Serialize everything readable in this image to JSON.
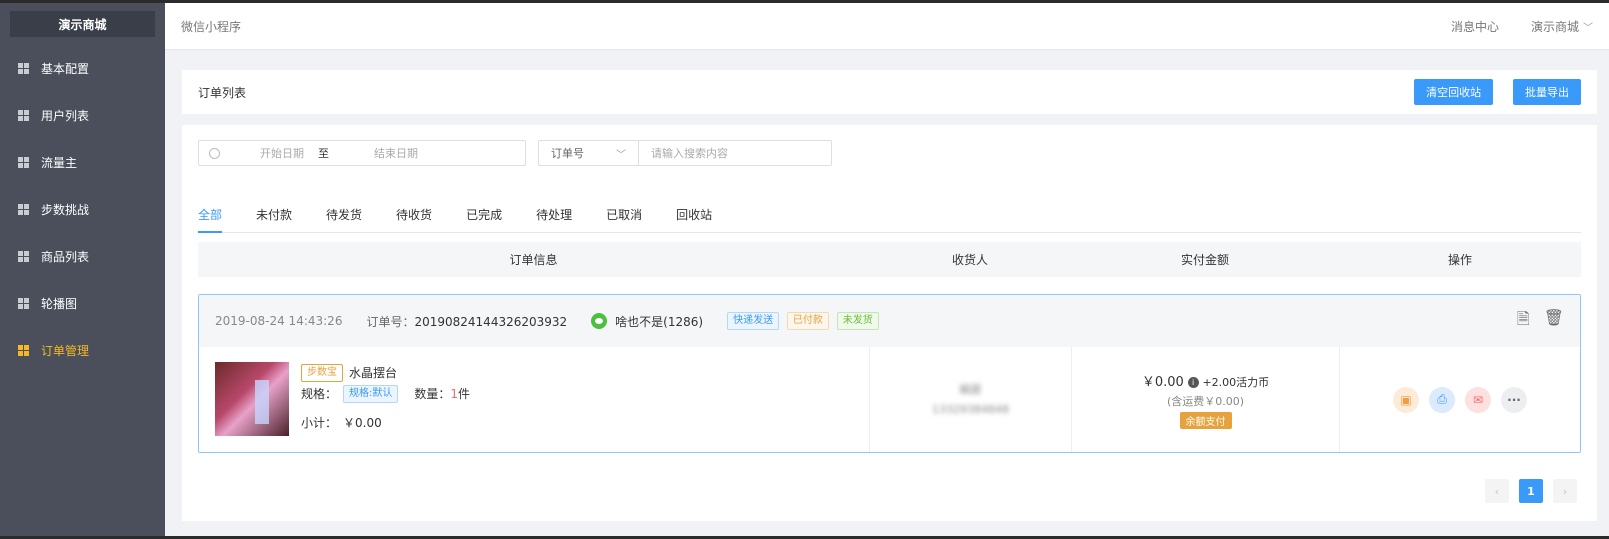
{
  "sidebar": {
    "brand": "演示商城",
    "items": [
      {
        "label": "基本配置",
        "active": false
      },
      {
        "label": "用户列表",
        "active": false
      },
      {
        "label": "流量主",
        "active": false
      },
      {
        "label": "步数挑战",
        "active": false
      },
      {
        "label": "商品列表",
        "active": false
      },
      {
        "label": "轮播图",
        "active": false
      },
      {
        "label": "订单管理",
        "active": true
      }
    ]
  },
  "topbar": {
    "breadcrumb": "微信小程序",
    "messages": "消息中心",
    "store": "演示商城"
  },
  "page": {
    "title": "订单列表",
    "clear_recycle": "清空回收站",
    "batch_export": "批量导出"
  },
  "filter": {
    "start_placeholder": "开始日期",
    "separator": "至",
    "end_placeholder": "结束日期",
    "search_type": "订单号",
    "search_placeholder": "请输入搜索内容"
  },
  "tabs": [
    "全部",
    "未付款",
    "待发货",
    "待收货",
    "已完成",
    "待处理",
    "已取消",
    "回收站"
  ],
  "active_tab": 0,
  "table": {
    "headers": [
      "订单信息",
      "收货人",
      "实付金额",
      "操作"
    ]
  },
  "order": {
    "time": "2019-08-24 14:43:26",
    "no_label": "订单号：",
    "no": "20190824144326203932",
    "buyer": "啥也不是(1286)",
    "tags": [
      "快递发送",
      "已付款",
      "未发货"
    ],
    "product": {
      "badge": "步数宝",
      "name": "水晶摆台",
      "spec_label": "规格：",
      "spec": "规格:默认",
      "qty_label": "数量：",
      "qty": "1",
      "qty_unit": "件",
      "subtotal_label": "小计：",
      "subtotal": "￥0.00"
    },
    "receiver": {
      "name": "蜗居",
      "phone": "13329384848"
    },
    "amount": {
      "price": "￥0.00",
      "coins": "+2.00活力币",
      "shipping": "(含运费￥0.00)",
      "pay_method": "余额支付"
    }
  },
  "pagination": {
    "current": "1",
    "prev": "‹",
    "next": "›"
  },
  "colors": {
    "primary": "#3a9af9",
    "sidebar": "#4a4f5b",
    "active_nav": "#f7b824"
  }
}
